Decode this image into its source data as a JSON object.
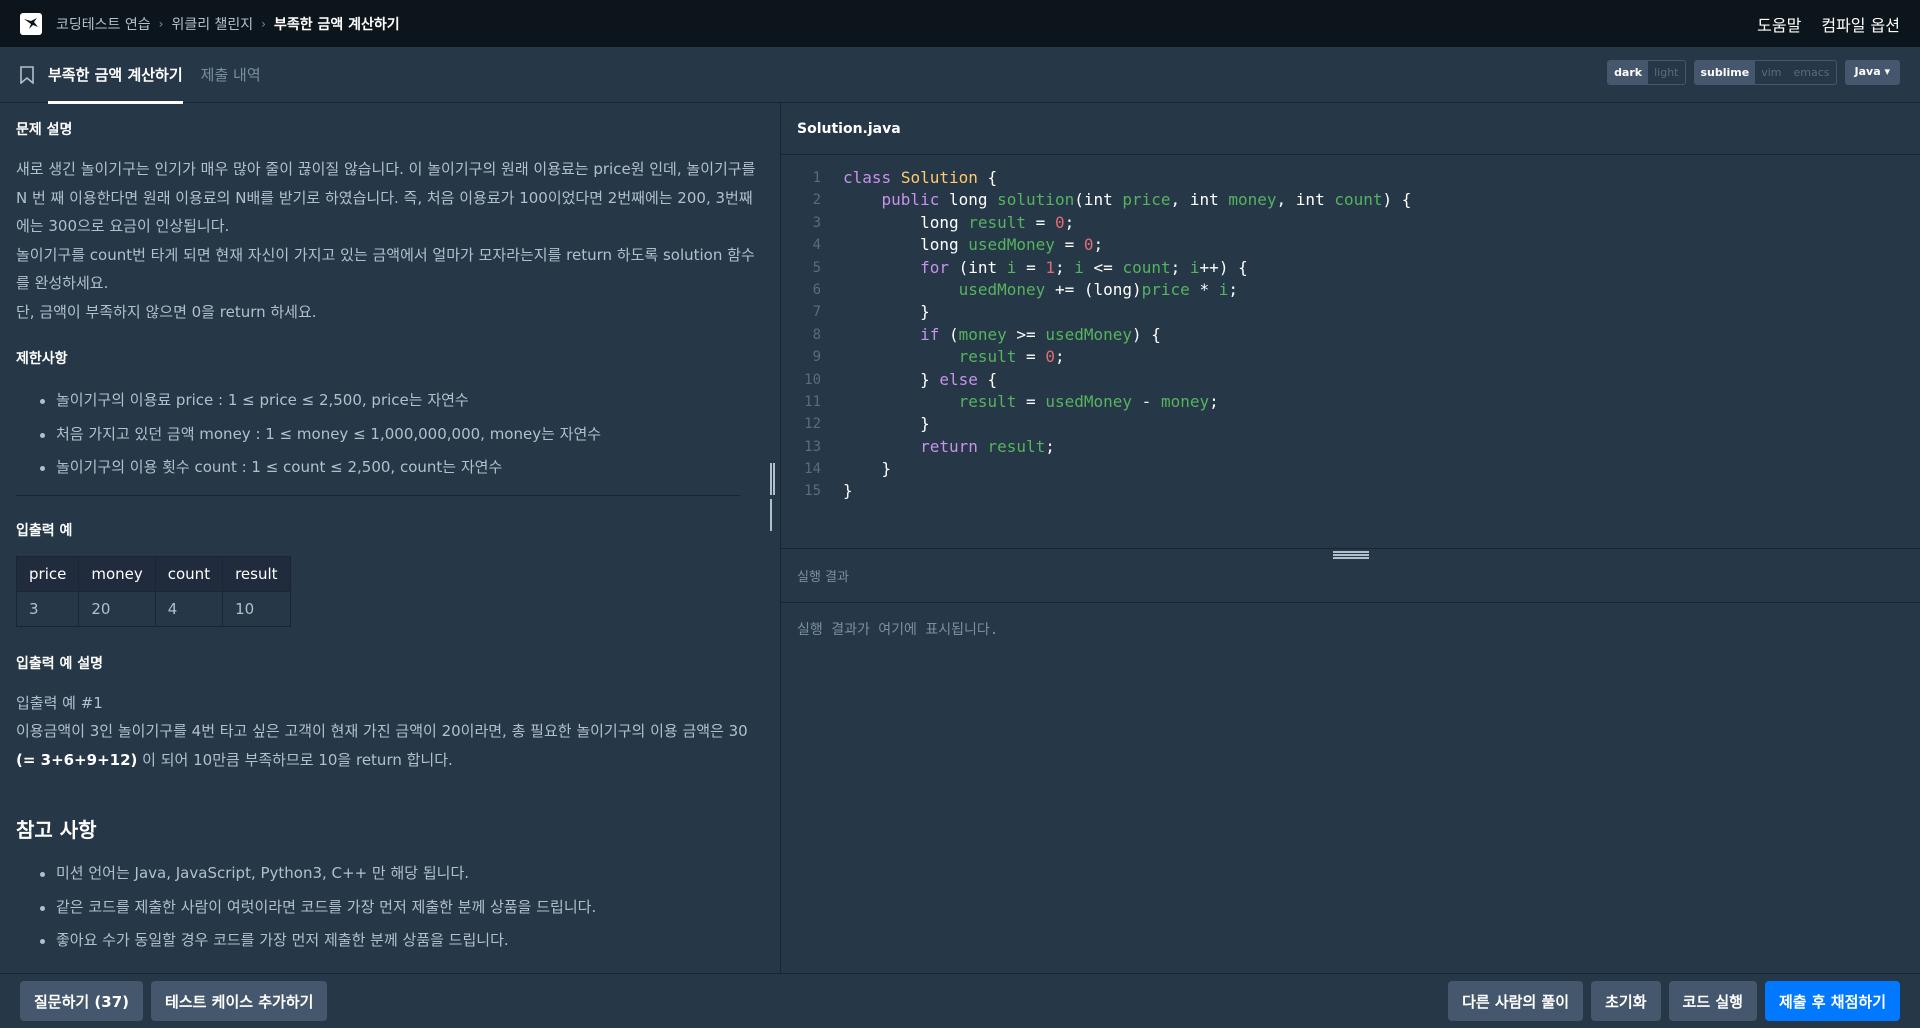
{
  "nav": {
    "breadcrumb": [
      "코딩테스트 연습",
      "위클리 챌린지",
      "부족한 금액 계산하기"
    ],
    "help": "도움말",
    "compile_options": "컴파일 옵션"
  },
  "tabs": {
    "problem": "부족한 금액 계산하기",
    "history": "제출 내역"
  },
  "tools": {
    "theme": [
      "dark",
      "light"
    ],
    "keymap": [
      "sublime",
      "vim",
      "emacs"
    ],
    "language": "Java"
  },
  "problem": {
    "desc_title": "문제 설명",
    "desc": [
      "새로 생긴 놀이기구는 인기가 매우 많아 줄이 끊이질 않습니다. 이 놀이기구의 원래 이용료는 price원 인데, 놀이기구를 N 번 째 이용한다면 원래 이용료의 N배를 받기로 하였습니다. 즉, 처음 이용료가 100이었다면 2번째에는 200, 3번째에는 300으로 요금이 인상됩니다.",
      "놀이기구를 count번 타게 되면 현재 자신이 가지고 있는 금액에서 얼마가 모자라는지를 return 하도록 solution 함수를 완성하세요.",
      "단, 금액이 부족하지 않으면 0을 return 하세요."
    ],
    "limits_title": "제한사항",
    "limits": [
      "놀이기구의 이용료 price : 1 ≤ price ≤ 2,500, price는 자연수",
      "처음 가지고 있던 금액 money : 1 ≤ money ≤ 1,000,000,000, money는 자연수",
      "놀이기구의 이용 횟수 count : 1 ≤ count ≤ 2,500, count는 자연수"
    ],
    "io_title": "입출력 예",
    "io_headers": [
      "price",
      "money",
      "count",
      "result"
    ],
    "io_row": [
      "3",
      "20",
      "4",
      "10"
    ],
    "io_desc_title": "입출력 예 설명",
    "io_example": "입출력 예 #1",
    "io_desc_1": "이용금액이 3인 놀이기구를 4번 타고 싶은 고객이 현재 가진 금액이 20이라면, 총 필요한 놀이기구의 이용 금액은 30 ",
    "io_desc_bold": "(= 3+6+9+12)",
    "io_desc_2": " 이 되어 10만큼 부족하므로 10을 return 합니다.",
    "note_title": "참고 사항",
    "notes": [
      "미션 언어는 Java, JavaScript, Python3, C++ 만 해당 됩니다.",
      "같은 코드를 제출한 사람이 여럿이라면 코드를 가장 먼저 제출한 분께 상품을 드립니다.",
      "좋아요 수가 동일할 경우 코드를 가장 먼저 제출한 분께 상품을 드립니다."
    ]
  },
  "editor": {
    "filename": "Solution.java",
    "line_numbers": [
      "1",
      "2",
      "3",
      "4",
      "5",
      "6",
      "7",
      "8",
      "9",
      "10",
      "11",
      "12",
      "13",
      "14",
      "15"
    ]
  },
  "result": {
    "title": "실행 결과",
    "placeholder": "실행 결과가 여기에 표시됩니다."
  },
  "footer": {
    "question": "질문하기 (37)",
    "add_testcase": "테스트 케이스 추가하기",
    "others": "다른 사람의 풀이",
    "reset": "초기화",
    "run": "코드 실행",
    "submit": "제출 후 채점하기"
  },
  "colors": {
    "background": "#263747",
    "topnav": "#0c151c",
    "primary": "#0078ff",
    "button": "#44576c"
  }
}
